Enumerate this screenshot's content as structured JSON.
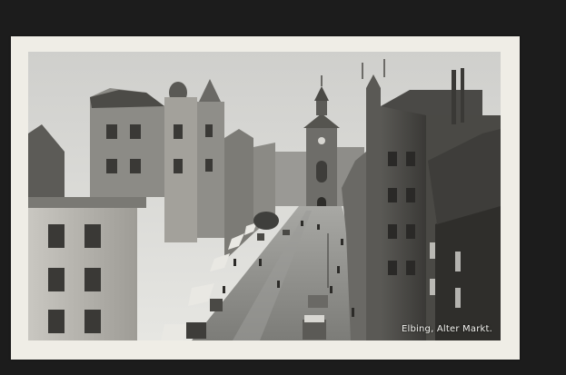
{
  "postcard": {
    "caption": "Elbing, Alter Markt."
  },
  "colors": {
    "background": "#1c1c1c",
    "card": "#efede6",
    "sky": "#d9d9d6",
    "street": "#8d8d89",
    "buildings_dark": "#3a3a38",
    "buildings_light": "#b8b6b0"
  }
}
